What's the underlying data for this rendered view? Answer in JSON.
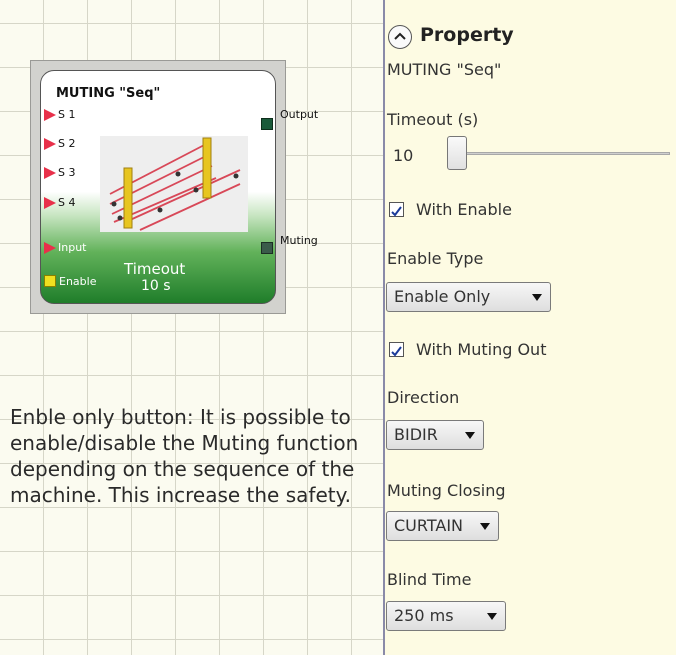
{
  "block": {
    "title": "MUTING \"Seq\"",
    "inputs": [
      "S 1",
      "S 2",
      "S 3",
      "S 4",
      "Input",
      "Enable"
    ],
    "outputs": [
      "Output",
      "Muting"
    ],
    "timeout_label": "Timeout",
    "timeout_value": "10 s"
  },
  "description": "Enble only button: It is possible to enable/disable the Muting function depending on the sequence of the machine. This increase the safety.",
  "property_panel": {
    "header": "Property",
    "block_name": "MUTING \"Seq\"",
    "timeout": {
      "label": "Timeout (s)",
      "value": "10",
      "slider_fraction": 0.0
    },
    "with_enable": {
      "label": "With Enable",
      "checked": true
    },
    "enable_type": {
      "label": "Enable Type",
      "value": "Enable Only"
    },
    "with_muting_out": {
      "label": "With Muting Out",
      "checked": true
    },
    "direction": {
      "label": "Direction",
      "value": "BIDIR"
    },
    "muting_closing": {
      "label": "Muting Closing",
      "value": "CURTAIN"
    },
    "blind_time": {
      "label": "Blind Time",
      "value": "250 ms"
    }
  },
  "colors": {
    "input_pin": "#e8304a",
    "enable_pin": "#f0e020",
    "output_pin": "#1a5a3a",
    "block_green": "#1f7d2a"
  }
}
